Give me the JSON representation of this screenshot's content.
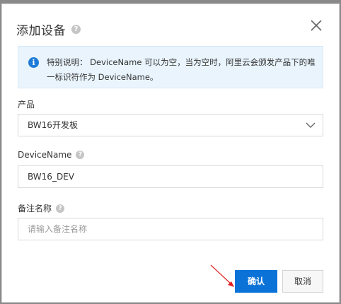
{
  "dialog": {
    "title": "添加设备",
    "title_help": "?",
    "close": "×",
    "info": {
      "icon": "i",
      "text": "特别说明： DeviceName 可以为空，当为空时，阿里云会颁发产品下的唯一标识符作为 DeviceName。"
    },
    "fields": {
      "product": {
        "label": "产品",
        "value": "BW16开发板"
      },
      "device_name": {
        "label": "DeviceName",
        "help": "?",
        "value": "BW16_DEV"
      },
      "remark": {
        "label": "备注名称",
        "help": "?",
        "placeholder": "请输入备注名称"
      }
    },
    "buttons": {
      "confirm": "确认",
      "cancel": "取消"
    }
  },
  "colors": {
    "primary": "#0b73d8",
    "info_bg": "#e9f4fd",
    "info_icon": "#1f7bd8",
    "annotation_arrow": "#e02020"
  }
}
